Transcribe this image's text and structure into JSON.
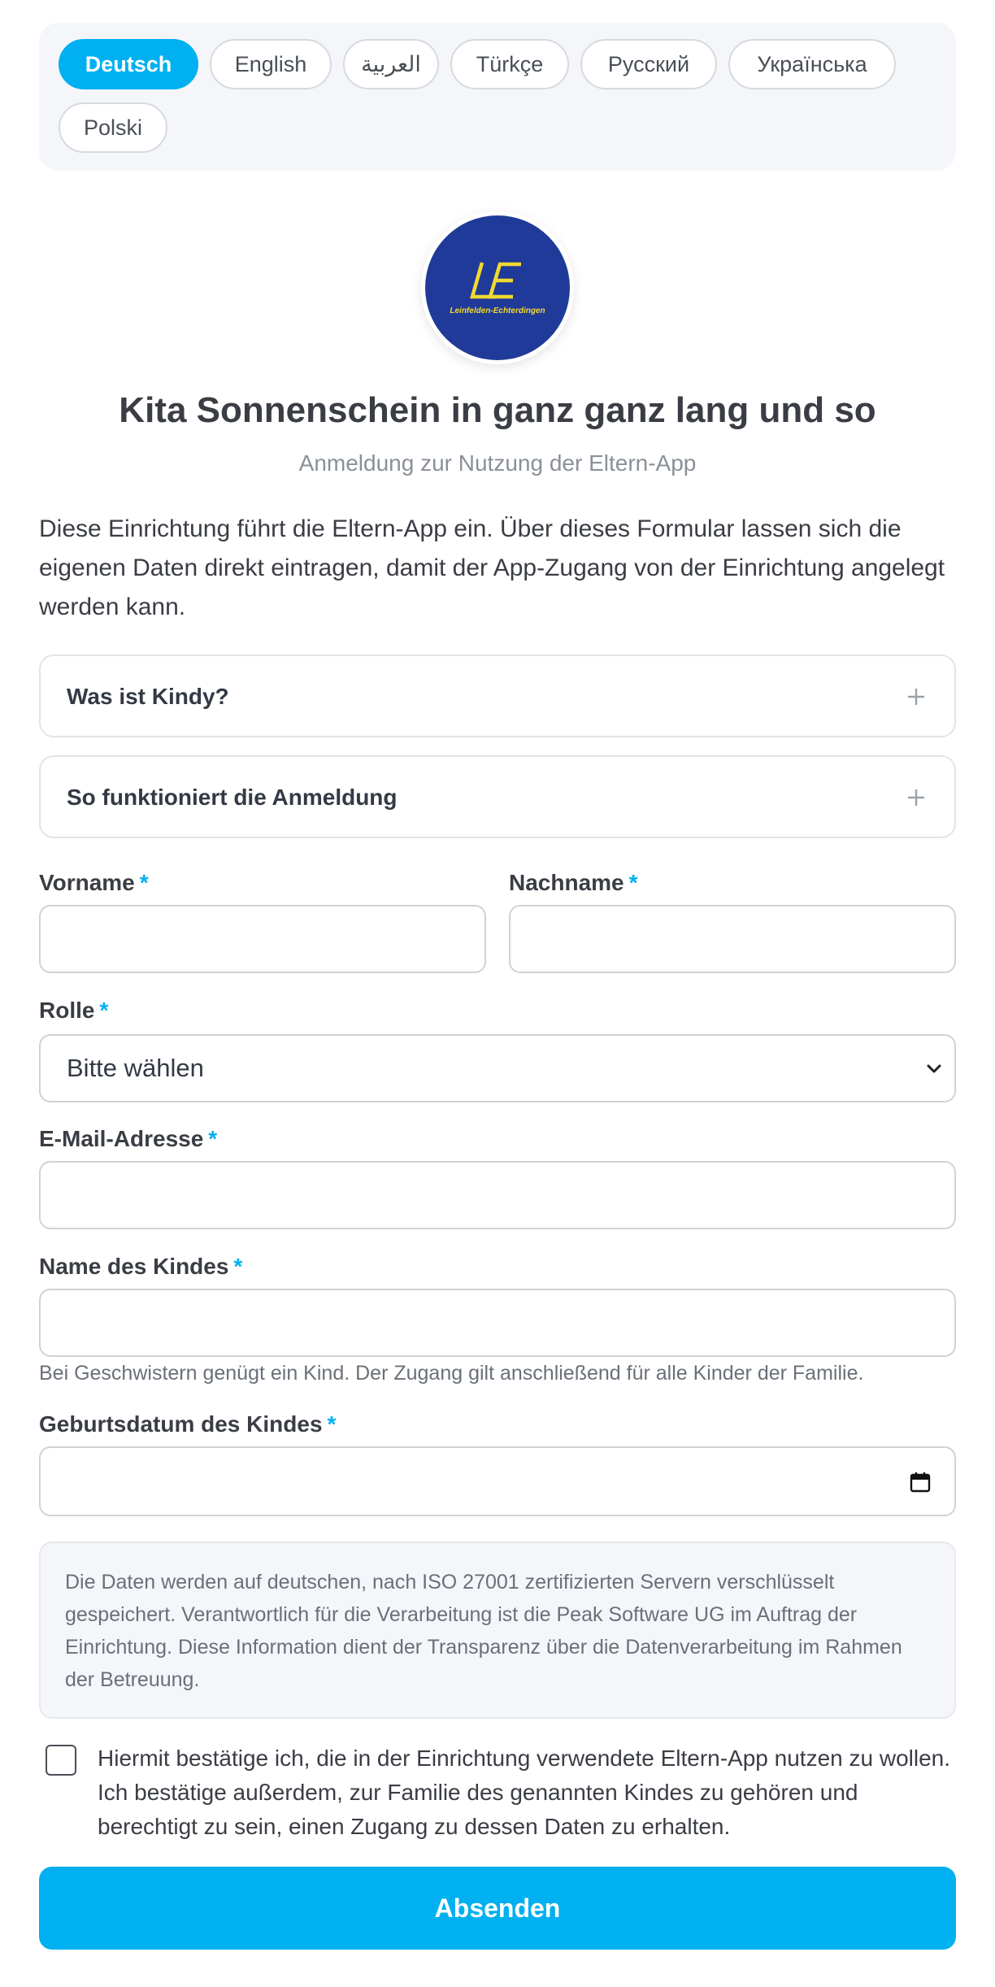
{
  "languages": [
    {
      "label": "Deutsch",
      "active": true
    },
    {
      "label": "English",
      "active": false
    },
    {
      "label": "العربية",
      "active": false
    },
    {
      "label": "Türkçe",
      "active": false
    },
    {
      "label": "Русский",
      "active": false
    },
    {
      "label": "Українська",
      "active": false
    },
    {
      "label": "Polski",
      "active": false
    }
  ],
  "logo": {
    "monogram": "LE",
    "caption": "Leinfelden-Echterdingen",
    "bg_color": "#1f3a98",
    "fg_color": "#f2d930"
  },
  "header": {
    "title": "Kita Sonnenschein in ganz ganz lang und so",
    "subtitle": "Anmeldung zur Nutzung der Eltern-App",
    "intro": "Diese Einrichtung führt die Eltern-App ein. Über dieses Formular lassen sich die eigenen Daten direkt eintragen, damit der App-Zugang von der Einrichtung angelegt werden kann."
  },
  "accordions": [
    {
      "title": "Was ist Kindy?",
      "icon": "plus-icon"
    },
    {
      "title": "So funktioniert die Anmeldung",
      "icon": "plus-icon"
    }
  ],
  "form": {
    "required_marker": "*",
    "first_name": {
      "label": "Vorname",
      "value": ""
    },
    "last_name": {
      "label": "Nachname",
      "value": ""
    },
    "role": {
      "label": "Rolle",
      "selected": "Bitte wählen"
    },
    "email": {
      "label": "E-Mail-Adresse",
      "value": ""
    },
    "child_name": {
      "label": "Name des Kindes",
      "value": "",
      "hint": "Bei Geschwistern genügt ein Kind. Der Zugang gilt anschließend für alle Kinder der Familie."
    },
    "child_birthdate": {
      "label": "Geburtsdatum des Kindes",
      "value": "",
      "icon": "calendar-icon"
    }
  },
  "privacy_note": "Die Daten werden auf deutschen, nach ISO 27001 zertifizierten Servern verschlüsselt gespeichert. Verantwortlich für die Verarbeitung ist die Peak Software UG im Auftrag der Einrichtung. Diese Information dient der Transparenz über die Datenverarbeitung im Rahmen der Betreuung.",
  "consent": {
    "checked": false,
    "text": "Hiermit bestätige ich, die in der Einrichtung verwendete Eltern-App nutzen zu wollen. Ich bestätige außerdem, zur Familie des genannten Kindes zu gehören und berechtigt zu sein, einen Zugang zu dessen Daten zu erhalten."
  },
  "submit_label": "Absenden",
  "colors": {
    "accent": "#00b0f0",
    "panel": "#f4f6fa",
    "text": "#333a45",
    "muted": "#8a9099"
  }
}
